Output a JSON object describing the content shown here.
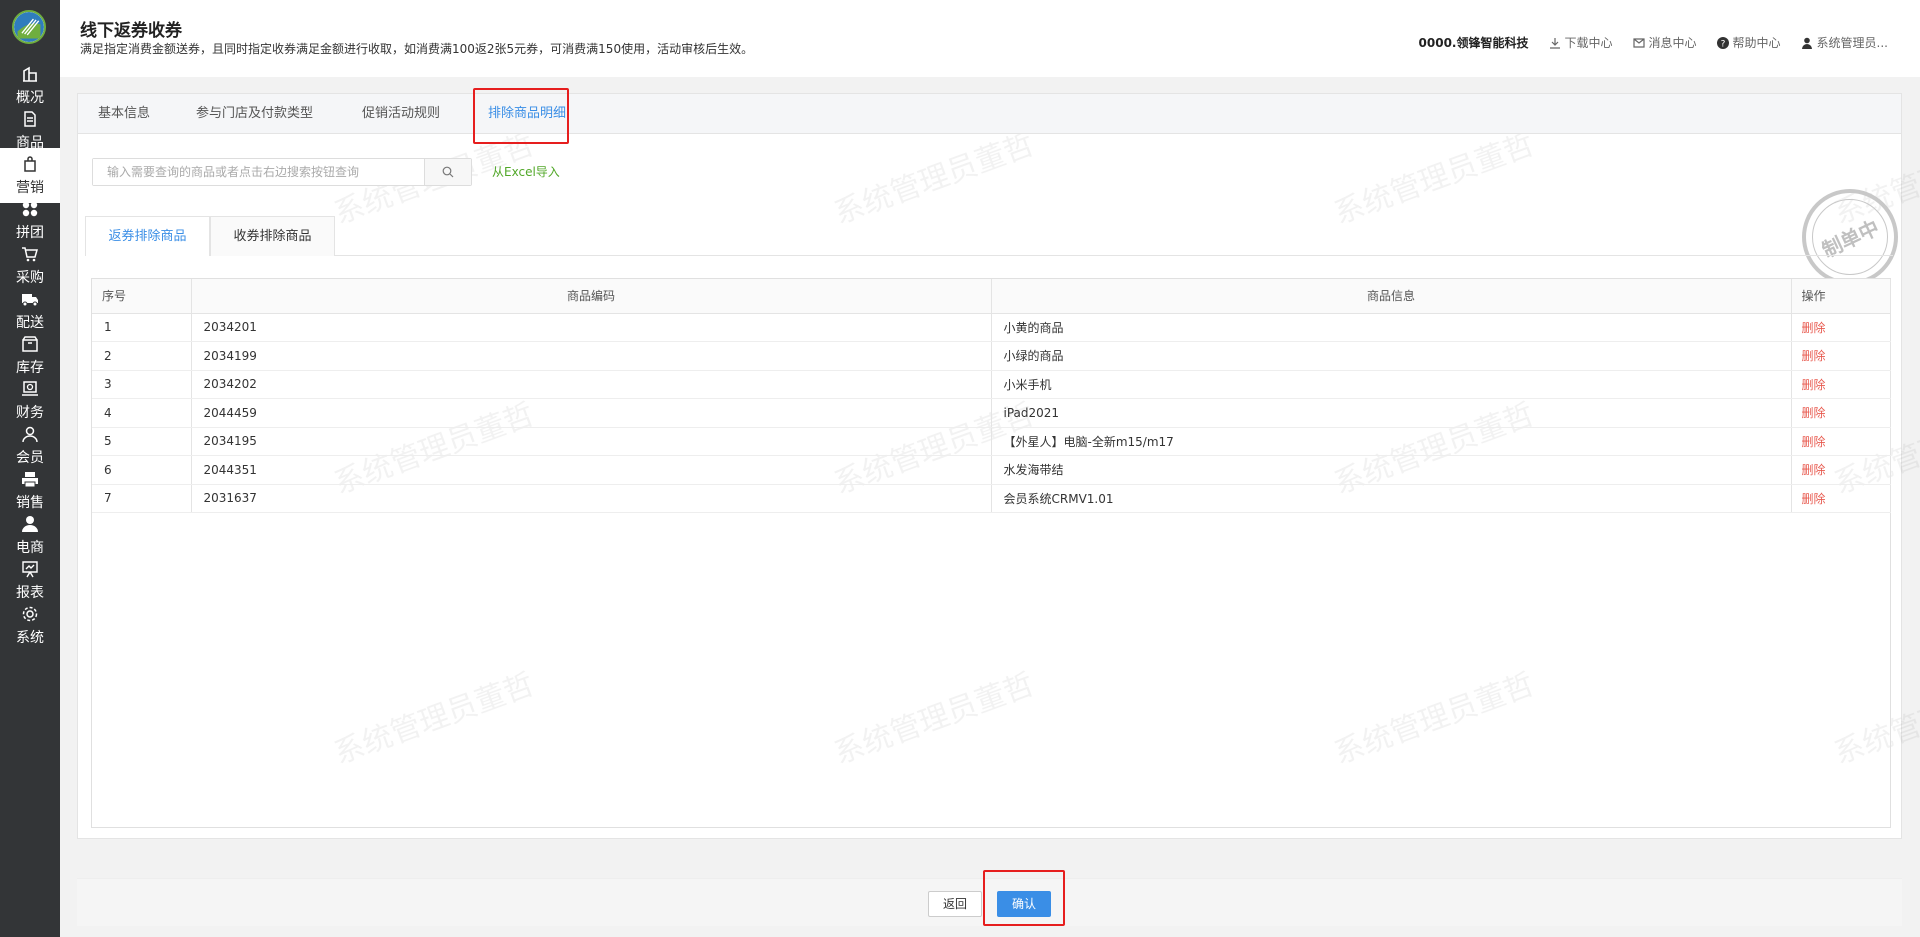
{
  "sidebar": {
    "items": [
      {
        "label": "概况",
        "icon": "building-icon"
      },
      {
        "label": "商品",
        "icon": "document-icon"
      },
      {
        "label": "营销",
        "icon": "shopping-bag-icon"
      },
      {
        "label": "拼团",
        "icon": "grid-icon"
      },
      {
        "label": "采购",
        "icon": "cart-icon"
      },
      {
        "label": "配送",
        "icon": "truck-icon"
      },
      {
        "label": "库存",
        "icon": "box-icon"
      },
      {
        "label": "财务",
        "icon": "money-icon"
      },
      {
        "label": "会员",
        "icon": "user-icon"
      },
      {
        "label": "销售",
        "icon": "printer-icon"
      },
      {
        "label": "电商",
        "icon": "person-icon"
      },
      {
        "label": "报表",
        "icon": "chart-board-icon"
      },
      {
        "label": "系统",
        "icon": "gear-icon"
      }
    ],
    "active_index": 2
  },
  "header": {
    "title": "线下返券收券",
    "description": "满足指定消费金额送券，且同时指定收券满足金额进行收取，如消费满100返2张5元券，可消费满150使用，活动审核后生效。",
    "company": "0000.领锋智能科技",
    "download": "下载中心",
    "messages": "消息中心",
    "help": "帮助中心",
    "user": "系统管理员..."
  },
  "tabs": [
    {
      "label": "基本信息"
    },
    {
      "label": "参与门店及付款类型"
    },
    {
      "label": "促销活动规则"
    },
    {
      "label": "排除商品明细"
    }
  ],
  "search": {
    "placeholder": "输入需要查询的商品或者点击右边搜索按钮查询",
    "value": ""
  },
  "excel_import": "从Excel导入",
  "subtabs": [
    {
      "label": "返券排除商品"
    },
    {
      "label": "收券排除商品"
    }
  ],
  "table": {
    "columns": [
      "序号",
      "商品编码",
      "商品信息",
      "操作"
    ],
    "rows": [
      {
        "no": "1",
        "code": "2034201",
        "info": "小黄的商品",
        "action": "删除"
      },
      {
        "no": "2",
        "code": "2034199",
        "info": "小绿的商品",
        "action": "删除"
      },
      {
        "no": "3",
        "code": "2034202",
        "info": "小米手机",
        "action": "删除"
      },
      {
        "no": "4",
        "code": "2044459",
        "info": "iPad2021",
        "action": "删除"
      },
      {
        "no": "5",
        "code": "2034195",
        "info": "【外星人】电脑-全新m15/m17",
        "action": "删除"
      },
      {
        "no": "6",
        "code": "2044351",
        "info": "水发海带结",
        "action": "删除"
      },
      {
        "no": "7",
        "code": "2031637",
        "info": "会员系统CRMV1.01",
        "action": "删除"
      }
    ]
  },
  "stamp": "制单中",
  "watermark": "系统管理员董哲",
  "footer": {
    "back": "返回",
    "confirm": "确认"
  },
  "colors": {
    "sidebar_bg": "#333537",
    "accent": "#3a8ee6",
    "highlight": "#e61e1e",
    "delete": "#e85a4f",
    "excel": "#52a829"
  }
}
